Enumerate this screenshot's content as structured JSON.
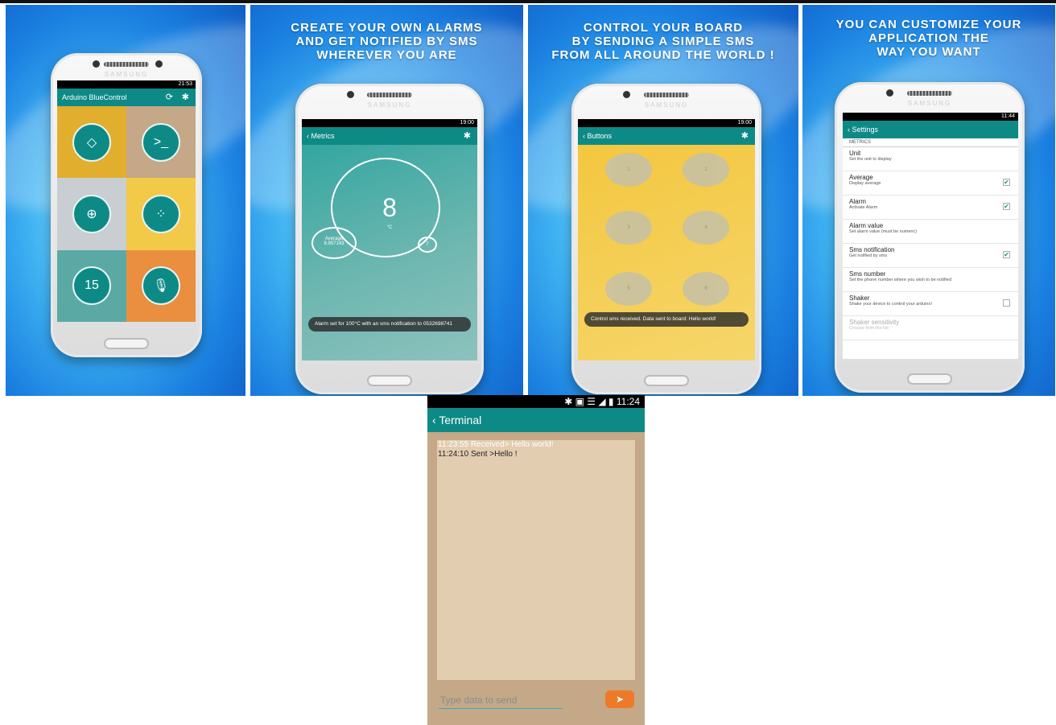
{
  "panels": {
    "p1": {
      "status_time": "21:53",
      "app_title": "Arduino BlueControl",
      "tiles": [
        "Arrow Keys",
        "Terminal",
        "Accelerometer",
        "Metrics & Slider",
        "15",
        "Voice Control"
      ]
    },
    "p2": {
      "caption": "CREATE YOUR OWN ALARMS\nAND GET NOTIFIED BY SMS\nWHEREVER YOU ARE",
      "status_time": "19:00",
      "screen_title": "Metrics",
      "value": "8",
      "unit": "°C",
      "average_label": "Average",
      "average_value": "8.957143",
      "small_value": "7",
      "toast": "Alarm set for 100°C with an sms notification to 0532698741"
    },
    "p3": {
      "caption": "CONTROL YOUR BOARD\nBY SENDING A SIMPLE SMS\nFROM ALL AROUND THE WORLD !",
      "status_time": "19:00",
      "screen_title": "Buttons",
      "buttons": [
        "1",
        "2",
        "3",
        "4",
        "5",
        "6"
      ],
      "toast": "Control sms received. Data sent to board: Hello world!"
    },
    "p4": {
      "caption": "YOU CAN CUSTOMIZE YOUR\nAPPLICATION THE\nWAY YOU WANT",
      "status_time": "11:44",
      "screen_title": "Settings",
      "section": "METRICS",
      "rows": [
        {
          "title": "Unit",
          "sub": "Set the unit to display",
          "check": null
        },
        {
          "title": "Average",
          "sub": "Display average",
          "check": true
        },
        {
          "title": "Alarm",
          "sub": "Activate Alarm",
          "check": true
        },
        {
          "title": "Alarm value",
          "sub": "Set alarm value (must be numeric)",
          "check": null
        },
        {
          "title": "Sms notification",
          "sub": "Get notified by sms",
          "check": true
        },
        {
          "title": "Sms number",
          "sub": "Set the phone number where you wish to be notified",
          "check": null
        },
        {
          "title": "Shaker",
          "sub": "Shake your device to control your arduino!",
          "check": false
        },
        {
          "title": "Shaker sensitivity",
          "sub": "Choose from the list",
          "check": null
        }
      ]
    }
  },
  "terminal": {
    "status_time": "11:24",
    "title": "Terminal",
    "log_received": "11:23:55 Received> Hello world!",
    "log_sent": "11:24:10 Sent >Hello !",
    "input_placeholder": "Type data to send",
    "send_label": "➤"
  },
  "brand": "SAMSUNG"
}
